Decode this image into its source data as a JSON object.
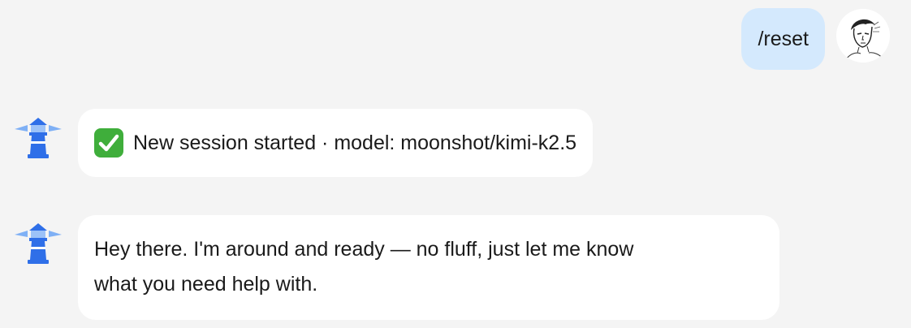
{
  "messages": {
    "user_1": {
      "text": "/reset",
      "avatar_icon": "user-sketch-avatar-icon"
    },
    "bot_1": {
      "icon": "check-mark-icon",
      "text": "New session started · model: moonshot/kimi-k2.5"
    },
    "bot_2": {
      "line_1": "Hey there. I'm around and ready — no fluff, just let me know",
      "line_2": "what you need help with."
    }
  },
  "bot_avatar_icon": "lighthouse-icon",
  "colors": {
    "background": "#f4f4f4",
    "user_bubble": "#d4e9fd",
    "bot_bubble": "#ffffff",
    "lighthouse_blue": "#2f6fe8",
    "check_green": "#3fae3b"
  }
}
